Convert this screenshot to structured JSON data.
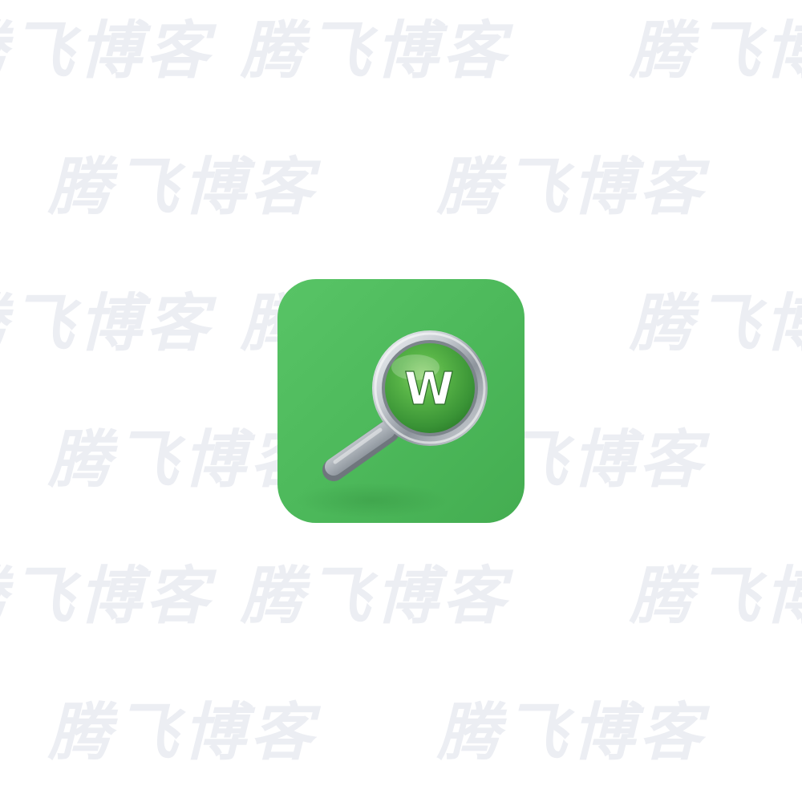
{
  "watermark": {
    "text": "腾飞博客",
    "color": "#eceef3"
  },
  "app_icon": {
    "name": "magnifier-w-icon",
    "letter": "W",
    "colors": {
      "background": "#4cb85a",
      "lens_green": "#3f9f3a",
      "ring_silver": "#c9ced3",
      "letter": "#ffffff"
    }
  }
}
